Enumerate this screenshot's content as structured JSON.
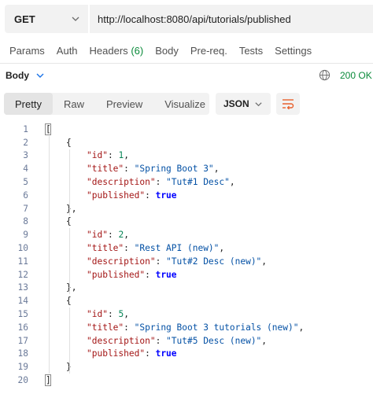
{
  "request": {
    "method": "GET",
    "url": "http://localhost:8080/api/tutorials/published"
  },
  "request_tabs": [
    {
      "label": "Params"
    },
    {
      "label": "Auth"
    },
    {
      "label": "Headers",
      "count": "(6)"
    },
    {
      "label": "Body"
    },
    {
      "label": "Pre-req."
    },
    {
      "label": "Tests"
    },
    {
      "label": "Settings"
    }
  ],
  "response": {
    "section_label": "Body",
    "status": "200 OK",
    "status_color": "#0a8a3a"
  },
  "view_tabs": [
    {
      "label": "Pretty",
      "active": true
    },
    {
      "label": "Raw"
    },
    {
      "label": "Preview"
    },
    {
      "label": "Visualize"
    }
  ],
  "format": "JSON",
  "code_lines": [
    {
      "n": "1",
      "indent": 0,
      "tokens": [
        {
          "t": "[",
          "c": "p"
        }
      ]
    },
    {
      "n": "2",
      "indent": 1,
      "tokens": [
        {
          "t": "{",
          "c": "p"
        }
      ]
    },
    {
      "n": "3",
      "indent": 2,
      "tokens": [
        {
          "t": "\"id\"",
          "c": "k"
        },
        {
          "t": ": ",
          "c": "p"
        },
        {
          "t": "1",
          "c": "n"
        },
        {
          "t": ",",
          "c": "p"
        }
      ]
    },
    {
      "n": "4",
      "indent": 2,
      "tokens": [
        {
          "t": "\"title\"",
          "c": "k"
        },
        {
          "t": ": ",
          "c": "p"
        },
        {
          "t": "\"Spring Boot 3\"",
          "c": "s"
        },
        {
          "t": ",",
          "c": "p"
        }
      ]
    },
    {
      "n": "5",
      "indent": 2,
      "tokens": [
        {
          "t": "\"description\"",
          "c": "k"
        },
        {
          "t": ": ",
          "c": "p"
        },
        {
          "t": "\"Tut#1 Desc\"",
          "c": "s"
        },
        {
          "t": ",",
          "c": "p"
        }
      ]
    },
    {
      "n": "6",
      "indent": 2,
      "tokens": [
        {
          "t": "\"published\"",
          "c": "k"
        },
        {
          "t": ": ",
          "c": "p"
        },
        {
          "t": "true",
          "c": "b"
        }
      ]
    },
    {
      "n": "7",
      "indent": 1,
      "tokens": [
        {
          "t": "},",
          "c": "p"
        }
      ]
    },
    {
      "n": "8",
      "indent": 1,
      "tokens": [
        {
          "t": "{",
          "c": "p"
        }
      ]
    },
    {
      "n": "9",
      "indent": 2,
      "tokens": [
        {
          "t": "\"id\"",
          "c": "k"
        },
        {
          "t": ": ",
          "c": "p"
        },
        {
          "t": "2",
          "c": "n"
        },
        {
          "t": ",",
          "c": "p"
        }
      ]
    },
    {
      "n": "10",
      "indent": 2,
      "tokens": [
        {
          "t": "\"title\"",
          "c": "k"
        },
        {
          "t": ": ",
          "c": "p"
        },
        {
          "t": "\"Rest API (new)\"",
          "c": "s"
        },
        {
          "t": ",",
          "c": "p"
        }
      ]
    },
    {
      "n": "11",
      "indent": 2,
      "tokens": [
        {
          "t": "\"description\"",
          "c": "k"
        },
        {
          "t": ": ",
          "c": "p"
        },
        {
          "t": "\"Tut#2 Desc (new)\"",
          "c": "s"
        },
        {
          "t": ",",
          "c": "p"
        }
      ]
    },
    {
      "n": "12",
      "indent": 2,
      "tokens": [
        {
          "t": "\"published\"",
          "c": "k"
        },
        {
          "t": ": ",
          "c": "p"
        },
        {
          "t": "true",
          "c": "b"
        }
      ]
    },
    {
      "n": "13",
      "indent": 1,
      "tokens": [
        {
          "t": "},",
          "c": "p"
        }
      ]
    },
    {
      "n": "14",
      "indent": 1,
      "tokens": [
        {
          "t": "{",
          "c": "p"
        }
      ]
    },
    {
      "n": "15",
      "indent": 2,
      "tokens": [
        {
          "t": "\"id\"",
          "c": "k"
        },
        {
          "t": ": ",
          "c": "p"
        },
        {
          "t": "5",
          "c": "n"
        },
        {
          "t": ",",
          "c": "p"
        }
      ]
    },
    {
      "n": "16",
      "indent": 2,
      "tokens": [
        {
          "t": "\"title\"",
          "c": "k"
        },
        {
          "t": ": ",
          "c": "p"
        },
        {
          "t": "\"Spring Boot 3 tutorials (new)\"",
          "c": "s"
        },
        {
          "t": ",",
          "c": "p"
        }
      ]
    },
    {
      "n": "17",
      "indent": 2,
      "tokens": [
        {
          "t": "\"description\"",
          "c": "k"
        },
        {
          "t": ": ",
          "c": "p"
        },
        {
          "t": "\"Tut#5 Desc (new)\"",
          "c": "s"
        },
        {
          "t": ",",
          "c": "p"
        }
      ]
    },
    {
      "n": "18",
      "indent": 2,
      "tokens": [
        {
          "t": "\"published\"",
          "c": "k"
        },
        {
          "t": ": ",
          "c": "p"
        },
        {
          "t": "true",
          "c": "b"
        }
      ]
    },
    {
      "n": "19",
      "indent": 1,
      "tokens": [
        {
          "t": "}",
          "c": "p"
        }
      ]
    },
    {
      "n": "20",
      "indent": 0,
      "tokens": [
        {
          "t": "]",
          "c": "p"
        }
      ]
    }
  ]
}
